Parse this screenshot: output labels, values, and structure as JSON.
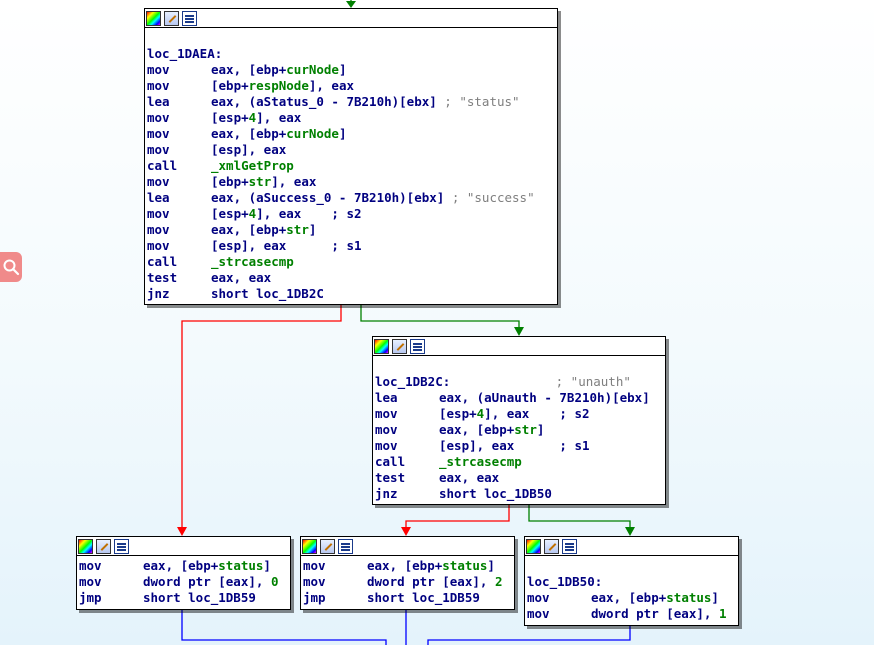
{
  "nodes": {
    "a": {
      "lines": [
        {
          "type": "blank"
        },
        {
          "type": "label",
          "text": "loc_1DAEA:"
        },
        {
          "type": "ins",
          "m": "mov",
          "parts": [
            [
              "t",
              "eax, [ebp+"
            ],
            [
              "n",
              "curNode"
            ],
            [
              "t",
              "]"
            ]
          ]
        },
        {
          "type": "ins",
          "m": "mov",
          "parts": [
            [
              "t",
              "[ebp+"
            ],
            [
              "n",
              "respNode"
            ],
            [
              "t",
              "], eax"
            ]
          ]
        },
        {
          "type": "ins",
          "m": "lea",
          "parts": [
            [
              "t",
              "eax, (aStatus_0 - 7B210h)[ebx] "
            ],
            [
              "c",
              "; \"status\""
            ]
          ]
        },
        {
          "type": "ins",
          "m": "mov",
          "parts": [
            [
              "t",
              "[esp+"
            ],
            [
              "n",
              "4"
            ],
            [
              "t",
              "], eax"
            ]
          ]
        },
        {
          "type": "ins",
          "m": "mov",
          "parts": [
            [
              "t",
              "eax, [ebp+"
            ],
            [
              "n",
              "curNode"
            ],
            [
              "t",
              "]"
            ]
          ]
        },
        {
          "type": "ins",
          "m": "mov",
          "parts": [
            [
              "t",
              "[esp], eax"
            ]
          ]
        },
        {
          "type": "ins",
          "m": "call",
          "parts": [
            [
              "f",
              "_xmlGetProp"
            ]
          ]
        },
        {
          "type": "ins",
          "m": "mov",
          "parts": [
            [
              "t",
              "[ebp+"
            ],
            [
              "n",
              "str"
            ],
            [
              "t",
              "], eax"
            ]
          ]
        },
        {
          "type": "ins",
          "m": "lea",
          "parts": [
            [
              "t",
              "eax, (aSuccess_0 - 7B210h)[ebx] "
            ],
            [
              "c",
              "; \"success\""
            ]
          ]
        },
        {
          "type": "ins",
          "m": "mov",
          "parts": [
            [
              "t",
              "[esp+"
            ],
            [
              "n",
              "4"
            ],
            [
              "t",
              "], eax    ; s2"
            ]
          ]
        },
        {
          "type": "ins",
          "m": "mov",
          "parts": [
            [
              "t",
              "eax, [ebp+"
            ],
            [
              "n",
              "str"
            ],
            [
              "t",
              "]"
            ]
          ]
        },
        {
          "type": "ins",
          "m": "mov",
          "parts": [
            [
              "t",
              "[esp], eax      ; s1"
            ]
          ]
        },
        {
          "type": "ins",
          "m": "call",
          "parts": [
            [
              "f",
              "_strcasecmp"
            ]
          ]
        },
        {
          "type": "ins",
          "m": "test",
          "parts": [
            [
              "t",
              "eax, eax"
            ]
          ]
        },
        {
          "type": "ins",
          "m": "jnz",
          "parts": [
            [
              "t",
              "short loc_1DB2C"
            ]
          ]
        }
      ]
    },
    "b": {
      "lines": [
        {
          "type": "blank"
        },
        {
          "type": "label",
          "text": "loc_1DB2C:",
          "comment": "; \"unauth\""
        },
        {
          "type": "ins",
          "m": "lea",
          "parts": [
            [
              "t",
              "eax, (aUnauth - 7B210h)[ebx]"
            ]
          ]
        },
        {
          "type": "ins",
          "m": "mov",
          "parts": [
            [
              "t",
              "[esp+"
            ],
            [
              "n",
              "4"
            ],
            [
              "t",
              "], eax    ; s2"
            ]
          ]
        },
        {
          "type": "ins",
          "m": "mov",
          "parts": [
            [
              "t",
              "eax, [ebp+"
            ],
            [
              "n",
              "str"
            ],
            [
              "t",
              "]"
            ]
          ]
        },
        {
          "type": "ins",
          "m": "mov",
          "parts": [
            [
              "t",
              "[esp], eax      ; s1"
            ]
          ]
        },
        {
          "type": "ins",
          "m": "call",
          "parts": [
            [
              "f",
              "_strcasecmp"
            ]
          ]
        },
        {
          "type": "ins",
          "m": "test",
          "parts": [
            [
              "t",
              "eax, eax"
            ]
          ]
        },
        {
          "type": "ins",
          "m": "jnz",
          "parts": [
            [
              "t",
              "short loc_1DB50"
            ]
          ]
        }
      ]
    },
    "c": {
      "lines": [
        {
          "type": "ins",
          "m": "mov",
          "parts": [
            [
              "t",
              "eax, [ebp+"
            ],
            [
              "n",
              "status"
            ],
            [
              "t",
              "]"
            ]
          ]
        },
        {
          "type": "ins",
          "m": "mov",
          "parts": [
            [
              "t",
              "dword ptr [eax], "
            ],
            [
              "n",
              "0"
            ]
          ]
        },
        {
          "type": "ins",
          "m": "jmp",
          "parts": [
            [
              "t",
              "short loc_1DB59"
            ]
          ]
        }
      ]
    },
    "d": {
      "lines": [
        {
          "type": "ins",
          "m": "mov",
          "parts": [
            [
              "t",
              "eax, [ebp+"
            ],
            [
              "n",
              "status"
            ],
            [
              "t",
              "]"
            ]
          ]
        },
        {
          "type": "ins",
          "m": "mov",
          "parts": [
            [
              "t",
              "dword ptr [eax], "
            ],
            [
              "n",
              "2"
            ]
          ]
        },
        {
          "type": "ins",
          "m": "jmp",
          "parts": [
            [
              "t",
              "short loc_1DB59"
            ]
          ]
        }
      ]
    },
    "e": {
      "lines": [
        {
          "type": "blank"
        },
        {
          "type": "label",
          "text": "loc_1DB50:"
        },
        {
          "type": "ins",
          "m": "mov",
          "parts": [
            [
              "t",
              "eax, [ebp+"
            ],
            [
              "n",
              "status"
            ],
            [
              "t",
              "]"
            ]
          ]
        },
        {
          "type": "ins",
          "m": "mov",
          "parts": [
            [
              "t",
              "dword ptr [eax], "
            ],
            [
              "n",
              "1"
            ]
          ]
        }
      ]
    }
  },
  "colors": {
    "edge_true": "#008000",
    "edge_false": "#ff0000",
    "edge_uncond": "#0000ff",
    "text": "#000080",
    "number": "#008000",
    "comment": "#7f7f7f",
    "search_tab": "#f08a8a"
  },
  "icons": [
    "color-icon",
    "rename-icon",
    "graph-icon",
    "search-icon"
  ]
}
